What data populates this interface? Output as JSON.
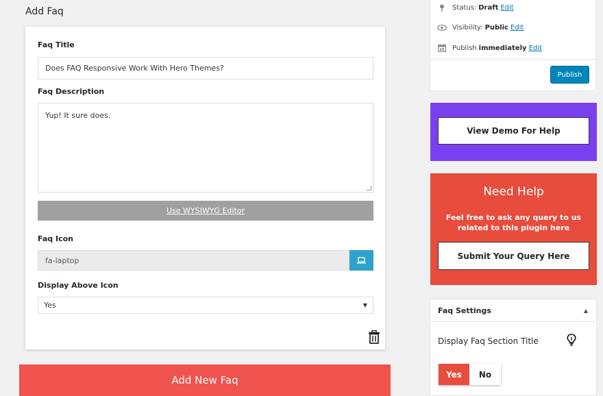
{
  "page": {
    "heading": "Add Faq"
  },
  "faq_form": {
    "title_label": "Faq Title",
    "title_value": "Does FAQ Responsive Work With Hero Themes?",
    "description_label": "Faq Description",
    "description_value": "Yup! It sure does.",
    "wysiwyg_label": "Use WYSIWYG Editor",
    "icon_label": "Faq Icon",
    "icon_value": "fa-laptop",
    "icon_button_icon": "laptop-icon",
    "display_above_label": "Display Above Icon",
    "display_above_value": "Yes",
    "delete_icon": "trash-icon"
  },
  "add_new": {
    "label": "Add New Faq"
  },
  "publish": {
    "status_label": "Status:",
    "status_value": "Draft",
    "status_edit": "Edit",
    "visibility_label": "Visibility:",
    "visibility_value": "Public",
    "visibility_edit": "Edit",
    "publish_label": "Publish",
    "publish_value": "immediately",
    "publish_edit": "Edit",
    "publish_button": "Publish"
  },
  "demo": {
    "button_label": "View Demo For Help",
    "bg_color": "#7b3ff2"
  },
  "help": {
    "title": "Need Help",
    "text": "Feel free to ask any query to us related to this plugin here",
    "button_label": "Submit Your Query Here",
    "bg_color": "#e74c3c"
  },
  "settings": {
    "header": "Faq Settings",
    "section_title_label": "Display Faq Section Title",
    "toggle_yes": "Yes",
    "toggle_no": "No",
    "toggle_selected": "Yes"
  },
  "colors": {
    "accent_red": "#f0524e",
    "primary_blue": "#0085ba",
    "icon_button_blue": "#2ea2cc"
  }
}
